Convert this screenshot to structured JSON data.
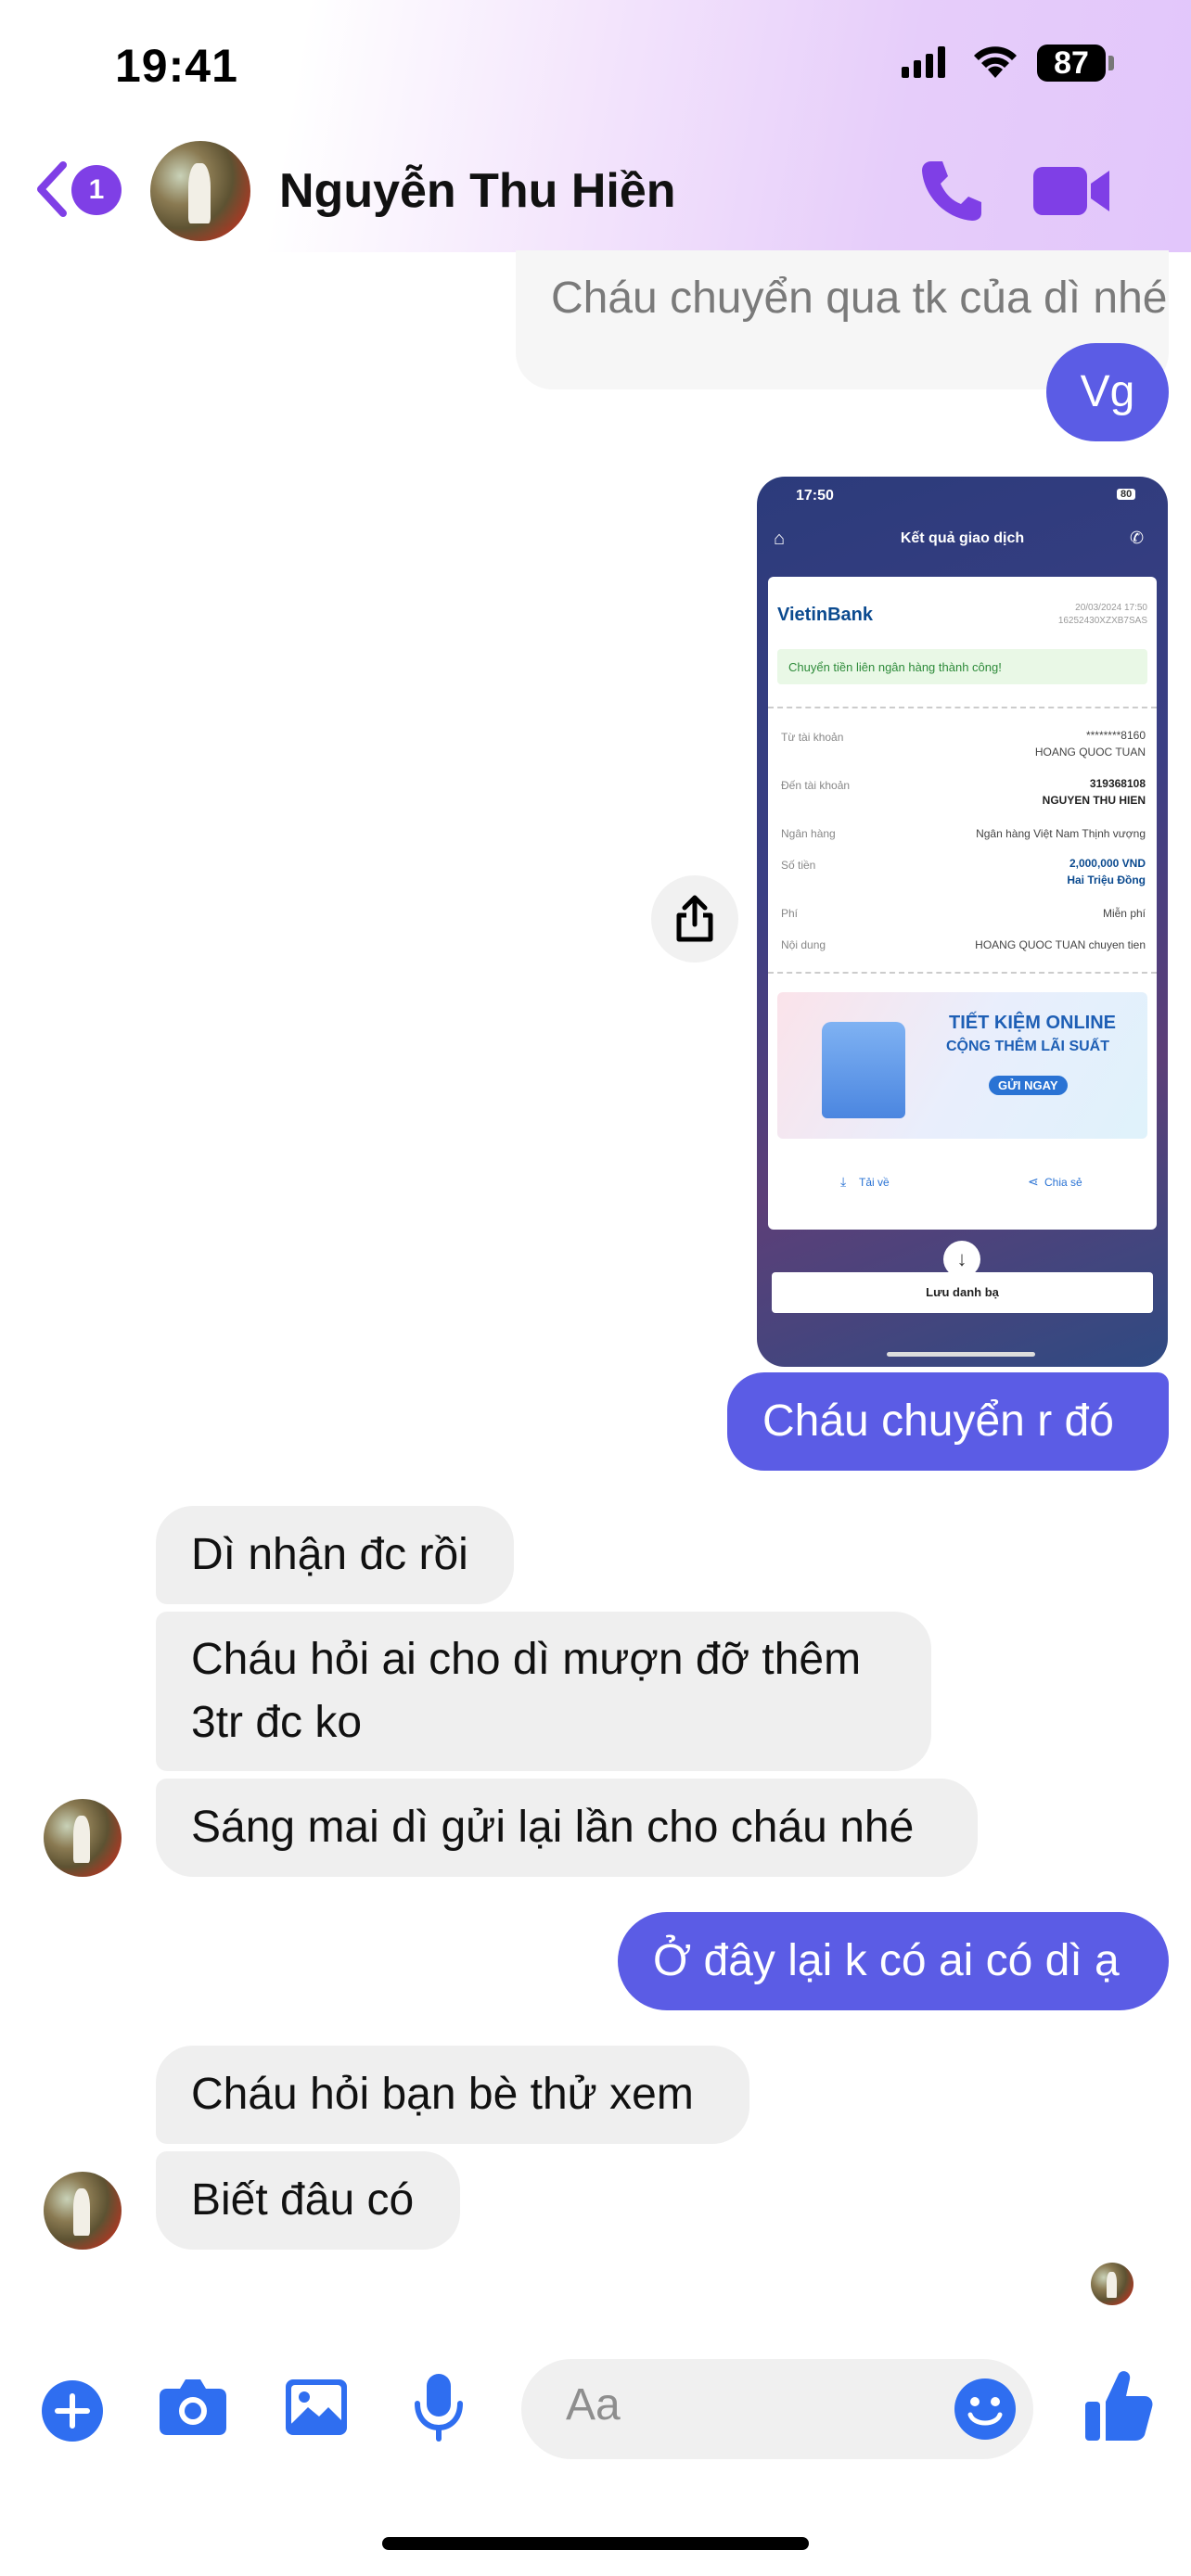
{
  "status_bar": {
    "time": "19:41",
    "battery": "87"
  },
  "header": {
    "back_badge": "1",
    "contact_name": "Nguyễn Thu Hiền"
  },
  "messages": {
    "m1": "Cháu chuyển qua tk của dì nhé",
    "m2": "Vg",
    "m3": "Cháu chuyển r đó",
    "m4": "Dì nhận đc rồi",
    "m5_line1": "Cháu hỏi ai cho dì mượn đỡ thêm",
    "m5_line2": "3tr đc ko",
    "m6": "Sáng mai dì gửi lại lần cho cháu nhé",
    "m7": "Ở đây lại k có ai có dì ạ",
    "m8": "Cháu hỏi bạn bè thử xem",
    "m9": "Biết đâu có"
  },
  "receipt": {
    "time": "17:50",
    "battery": "80",
    "title": "Kết quả giao dịch",
    "bank": "VietinBank",
    "datetime": "20/03/2024 17:50",
    "ref": "16252430XZXB7SAS",
    "success": "Chuyển tiền liên ngân hàng thành công!",
    "from_label": "Từ tài khoản",
    "from_acct": "********8160",
    "from_name": "HOANG QUOC TUAN",
    "to_label": "Đến tài khoản",
    "to_acct": "319368108",
    "to_name": "NGUYEN THU HIEN",
    "bank_label": "Ngân hàng",
    "bank_value": "Ngân hàng Việt Nam Thịnh vượng",
    "amount_label": "Số tiền",
    "amount": "2,000,000 VND",
    "amount_words": "Hai Triệu Đồng",
    "fee_label": "Phí",
    "fee": "Miễn phí",
    "content_label": "Nội dung",
    "content": "HOANG QUOC TUAN chuyen tien",
    "promo_line1": "TIẾT KIỆM ONLINE",
    "promo_line2": "CỘNG THÊM LÃI SUẤT",
    "promo_button": "GỬI NGAY",
    "download": "Tải về",
    "share": "Chia sẻ",
    "save_contact": "Lưu danh bạ"
  },
  "composer": {
    "placeholder": "Aa"
  },
  "colors": {
    "accent": "#7f3fe6",
    "outgoing": "#5b5ce5",
    "composer_icons": "#2f6ef0"
  }
}
